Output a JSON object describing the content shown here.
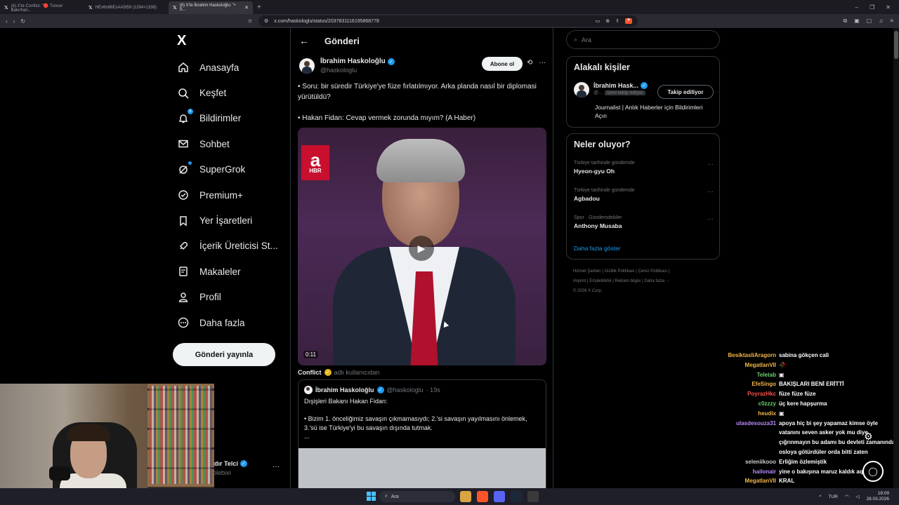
{
  "browser": {
    "tabs": [
      {
        "label": "(6) X'te Conflict: \"🔴 Tuncer Bakırhan..."
      },
      {
        "label": "HEx6n86EsAA5t59 (1284×1338)"
      },
      {
        "label": "(6) X'te İbrahim Haskoloğlu: \"• S..."
      }
    ],
    "url": "x.com/haskologlu/status/2037831116195868778"
  },
  "sidebar": {
    "logo": "X",
    "items": [
      {
        "label": "Anasayfa"
      },
      {
        "label": "Keşfet"
      },
      {
        "label": "Bildirimler",
        "badge": "6"
      },
      {
        "label": "Sohbet"
      },
      {
        "label": "SuperGrok"
      },
      {
        "label": "Premium+"
      },
      {
        "label": "Yer İşaretleri"
      },
      {
        "label": "İçerik Üreticisi St..."
      },
      {
        "label": "Makaleler"
      },
      {
        "label": "Profil"
      },
      {
        "label": "Daha fazla"
      }
    ],
    "post_button": "Gönderi yayınla",
    "account_name": "adır Telci",
    "account_handle": "rplebixi"
  },
  "main": {
    "header_title": "Gönderi",
    "author_name": "İbrahim Haskoloğlu",
    "author_handle": "@haskologlu",
    "subscribe_label": "Abone ol",
    "tweet_text": "• Soru: bir süredir Türkiye'ye füze fırlatılmıyor. Arka planda nasıl bir diplomasi yürütüldü?\n\n• Hakan Fidan: Cevap vermek zorunda mıyım? (A Haber)",
    "video_channel": "a",
    "video_channel_sub": "HBR",
    "video_time": "0:11",
    "attrib_name": "Conflict",
    "attrib_text": "adlı kullanıcıdan",
    "quote": {
      "name": "İbrahim Haskoloğlu",
      "handle": "@haskologlu",
      "time": "· 19s",
      "text": "Dışişleri Bakanı Hakan Fidan:\n\n• Bizim 1. önceliğimiz savaşın çıkmamasıydı; 2.'si savaşın yayılmasını önlemek, 3.'sü ise Türkiye'yi bu savaşın dışında tutmak.\n..."
    }
  },
  "right": {
    "search_placeholder": "Ara",
    "related_title": "Alakalı kişiler",
    "related_name": "İbrahim Hask...",
    "related_handle": "@...",
    "related_follows_you": "Seni takip ediyor",
    "related_follow_btn": "Takip ediliyor",
    "related_bio": "Journalist | Anlık Haberler için Bildirimleri Açın",
    "trends_title": "Neler oluyor?",
    "trends": [
      {
        "context": "Türkiye tarihinde gündemde",
        "name": "Hyeon-gyu Oh"
      },
      {
        "context": "Türkiye tarihinde gündemde",
        "name": "Agbadou"
      },
      {
        "context": "Spor · Gündemdekiler",
        "name": "Anthony Musaba"
      }
    ],
    "show_more": "Daha fazla göster",
    "footer_line1": "Hizmet Şartları  |  Gizlilik Politikası  |  Çerez Politikası  |",
    "footer_line2": "Imprint  |  Erişilebilirlik  |  Reklam bilgisi  |  Daha fazla ···",
    "footer_line3": "© 2026 X Corp."
  },
  "chat": [
    {
      "user": "BesiktasliAragorn",
      "color": "#f2b84b",
      "text": "sabina gökçen cali"
    },
    {
      "user": "MegatlanVII",
      "color": "#f2b84b",
      "text": "🥀"
    },
    {
      "user": "Teletab",
      "color": "#6ad06a",
      "text": "▣"
    },
    {
      "user": "EfeSingo",
      "color": "#f2b84b",
      "text": "BAKIŞLARI BENİ ERİTTİ"
    },
    {
      "user": "PoyrazHkc",
      "color": "#ff4f4f",
      "text": "füze füze füze"
    },
    {
      "user": "c0zzzy",
      "color": "#6ad06a",
      "text": "üç kere hapşurma"
    },
    {
      "user": "heudix",
      "color": "#f2b84b",
      "text": "▣"
    },
    {
      "user": "ulasdesouza31",
      "color": "#b98cff",
      "text": "apoya hiç bi şey yapamaz kimse öyle vatanını seven asker yok mu diye çığrınmayın bu adamı bu devleti zamanında osloya götürdüler orda bitti zaten"
    },
    {
      "user": "seleniikooo",
      "color": "#cccccc",
      "text": "Erliğim özlemiştik"
    },
    {
      "user": "hailonair",
      "color": "#b98cff",
      "text": "yine o bakışına maruz kaldık aq"
    },
    {
      "user": "MegatlanVII",
      "color": "#f2b84b",
      "text": "KRAL"
    }
  ],
  "taskbar": {
    "search": "Ara",
    "lang": "TUR",
    "time": "18:09",
    "date": "28.03.2026"
  }
}
